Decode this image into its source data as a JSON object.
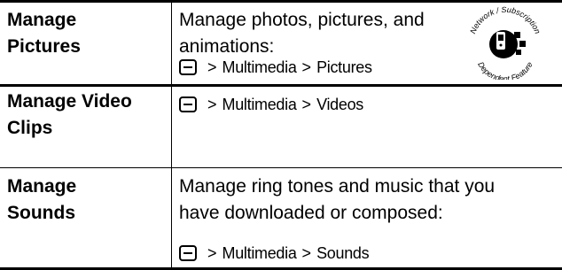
{
  "rows": [
    {
      "feature": [
        "Manage",
        "Pictures"
      ],
      "description": [
        "Manage photos, pictures, and",
        "animations:"
      ],
      "path": [
        "Multimedia",
        "Pictures"
      ]
    },
    {
      "feature": [
        "Manage Video",
        "Clips"
      ],
      "description": [],
      "path": [
        "Multimedia",
        "Videos"
      ]
    },
    {
      "feature": [
        "Manage",
        "Sounds"
      ],
      "description": [
        "Manage ring tones and music that you",
        "have downloaded or composed:"
      ],
      "path": [
        "Multimedia",
        "Sounds"
      ]
    }
  ],
  "separator": ">",
  "badge": {
    "top_text": "Network / Subscription",
    "bottom_text": "Dependent Feature",
    "icon": "phone-network-icon"
  }
}
